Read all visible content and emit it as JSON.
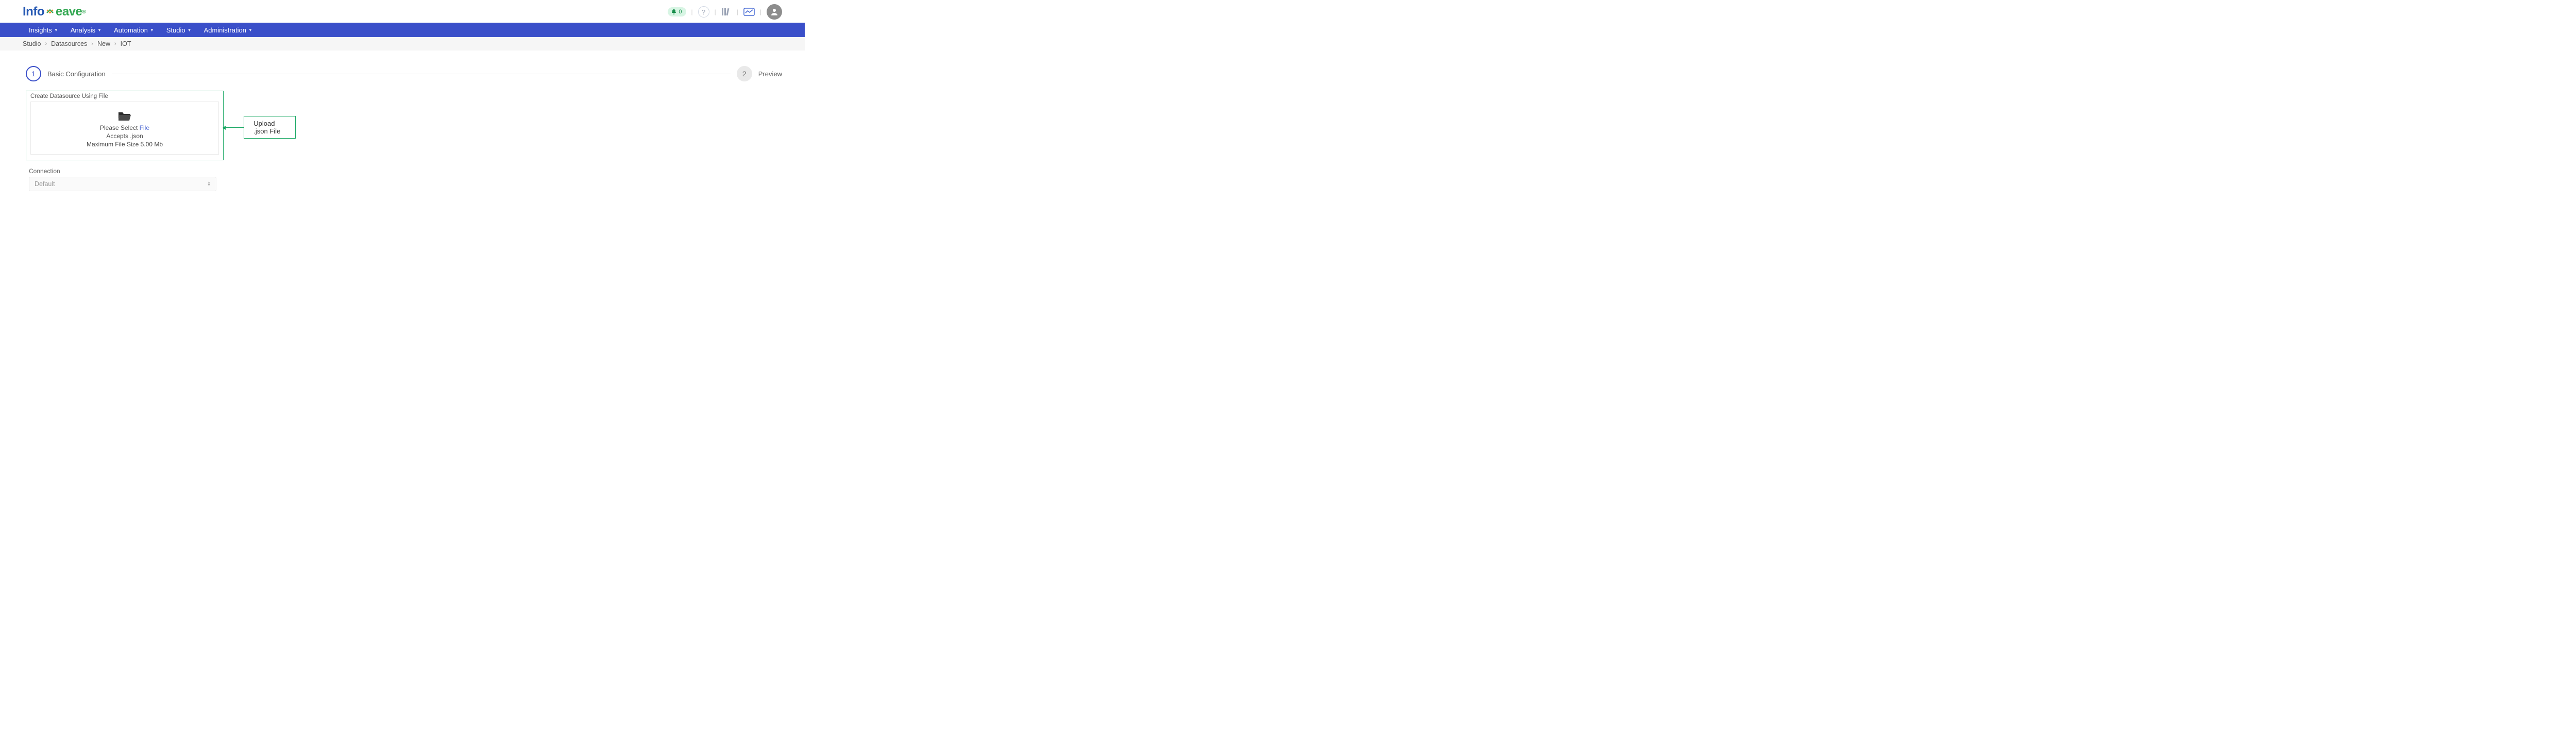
{
  "logo": {
    "left": "Info",
    "right": "eave"
  },
  "notif_count": "0",
  "nav": {
    "items": [
      {
        "label": "Insights"
      },
      {
        "label": "Analysis"
      },
      {
        "label": "Automation"
      },
      {
        "label": "Studio"
      },
      {
        "label": "Administration"
      }
    ]
  },
  "breadcrumb": {
    "items": [
      {
        "label": "Studio"
      },
      {
        "label": "Datasources"
      },
      {
        "label": "New"
      },
      {
        "label": "IOT"
      }
    ]
  },
  "steps": {
    "one_num": "1",
    "one_label": "Basic Configuration",
    "two_num": "2",
    "two_label": "Preview"
  },
  "upload": {
    "legend": "Create Datasource Using File",
    "select_prefix": "Please Select ",
    "select_link": "File",
    "accepts": "Accepts .json",
    "max": "Maximum File Size 5.00 Mb"
  },
  "callout": "Upload .json File",
  "connection": {
    "label": "Connection",
    "value": "Default"
  }
}
